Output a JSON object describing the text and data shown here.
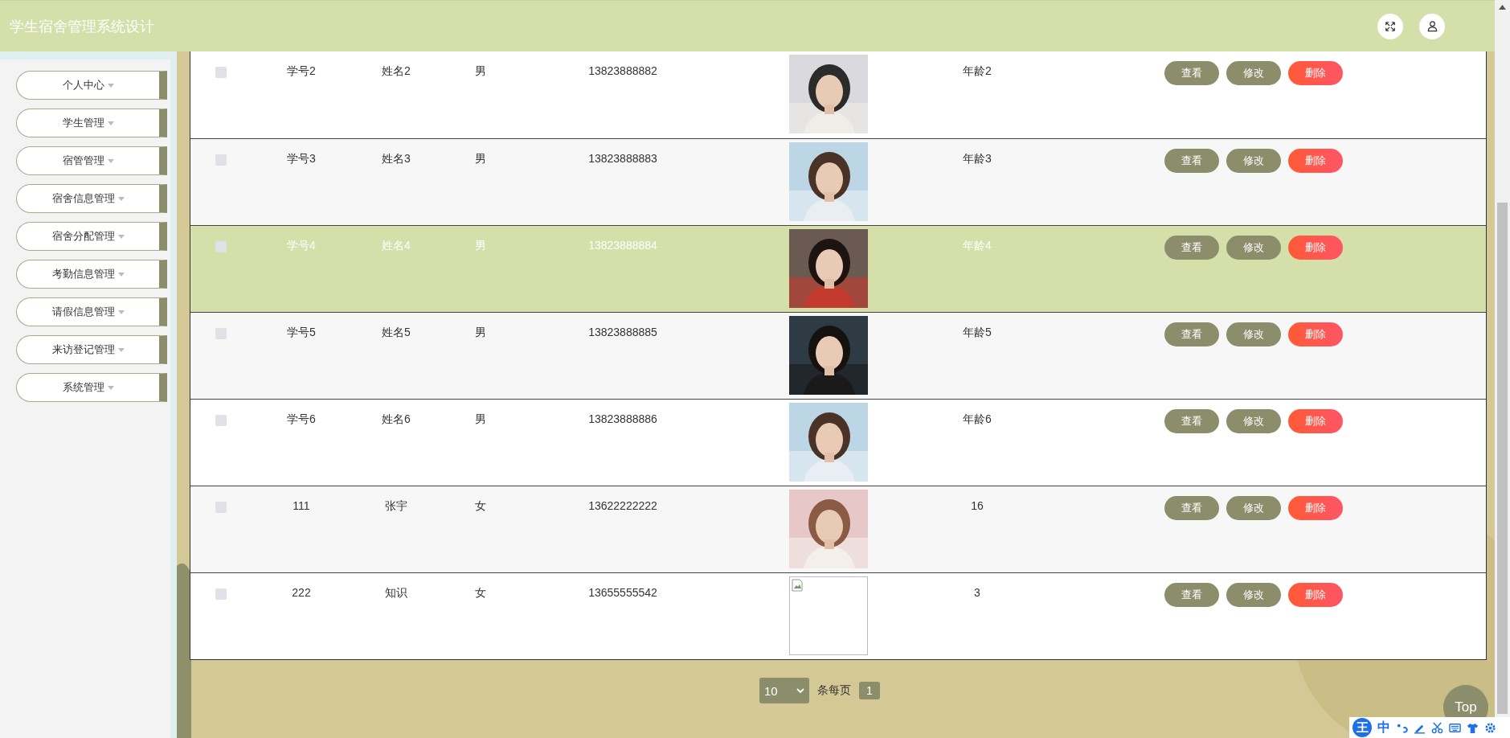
{
  "header": {
    "title": "学生宿舍管理系统设计"
  },
  "sidebar": {
    "items": [
      {
        "label": "个人中心"
      },
      {
        "label": "学生管理"
      },
      {
        "label": "宿管管理"
      },
      {
        "label": "宿舍信息管理"
      },
      {
        "label": "宿舍分配管理"
      },
      {
        "label": "考勤信息管理"
      },
      {
        "label": "请假信息管理"
      },
      {
        "label": "来访登记管理"
      },
      {
        "label": "系统管理"
      }
    ]
  },
  "table": {
    "rows": [
      {
        "selected": false,
        "checked": false,
        "cells": [
          "学号2",
          "姓名2",
          "男",
          "13823888882"
        ],
        "photo": {
          "kind": "picture"
        },
        "age": "年龄2",
        "actions": [
          {
            "label": "查看",
            "kind": "view"
          },
          {
            "label": "修改",
            "kind": "edit"
          },
          {
            "label": "删除",
            "kind": "delete"
          }
        ]
      },
      {
        "selected": false,
        "checked": false,
        "cells": [
          "学号3",
          "姓名3",
          "男",
          "13823888883"
        ],
        "photo": {
          "kind": "picture"
        },
        "age": "年龄3",
        "actions": [
          {
            "label": "查看",
            "kind": "view"
          },
          {
            "label": "修改",
            "kind": "edit"
          },
          {
            "label": "删除",
            "kind": "delete"
          }
        ]
      },
      {
        "selected": true,
        "checked": false,
        "cells": [
          "学号4",
          "姓名4",
          "男",
          "13823888884"
        ],
        "photo": {
          "kind": "picture"
        },
        "age": "年龄4",
        "actions": [
          {
            "label": "查看",
            "kind": "view"
          },
          {
            "label": "修改",
            "kind": "edit"
          },
          {
            "label": "删除",
            "kind": "delete"
          }
        ]
      },
      {
        "selected": false,
        "checked": false,
        "cells": [
          "学号5",
          "姓名5",
          "男",
          "13823888885"
        ],
        "photo": {
          "kind": "picture"
        },
        "age": "年龄5",
        "actions": [
          {
            "label": "查看",
            "kind": "view"
          },
          {
            "label": "修改",
            "kind": "edit"
          },
          {
            "label": "删除",
            "kind": "delete"
          }
        ]
      },
      {
        "selected": false,
        "checked": false,
        "cells": [
          "学号6",
          "姓名6",
          "男",
          "13823888886"
        ],
        "photo": {
          "kind": "picture"
        },
        "age": "年龄6",
        "actions": [
          {
            "label": "查看",
            "kind": "view"
          },
          {
            "label": "修改",
            "kind": "edit"
          },
          {
            "label": "删除",
            "kind": "delete"
          }
        ]
      },
      {
        "selected": false,
        "checked": false,
        "cells": [
          "111",
          "张宇",
          "女",
          "13622222222"
        ],
        "photo": {
          "kind": "picture"
        },
        "age": "16",
        "actions": [
          {
            "label": "查看",
            "kind": "view"
          },
          {
            "label": "修改",
            "kind": "edit"
          },
          {
            "label": "删除",
            "kind": "delete"
          }
        ]
      },
      {
        "selected": false,
        "checked": false,
        "cells": [
          "222",
          "知识",
          "女",
          "13655555542"
        ],
        "photo": {
          "kind": "broken"
        },
        "age": "3",
        "actions": [
          {
            "label": "查看",
            "kind": "view"
          },
          {
            "label": "修改",
            "kind": "edit"
          },
          {
            "label": "删除",
            "kind": "delete"
          }
        ]
      }
    ]
  },
  "pagination": {
    "page_size": "10",
    "per_page_label": "条每页",
    "pages": [
      {
        "label": "1",
        "selected": true
      }
    ]
  },
  "back_to_top": "Top",
  "ime_toolbar": {
    "logo": "王",
    "mode": "中"
  }
}
